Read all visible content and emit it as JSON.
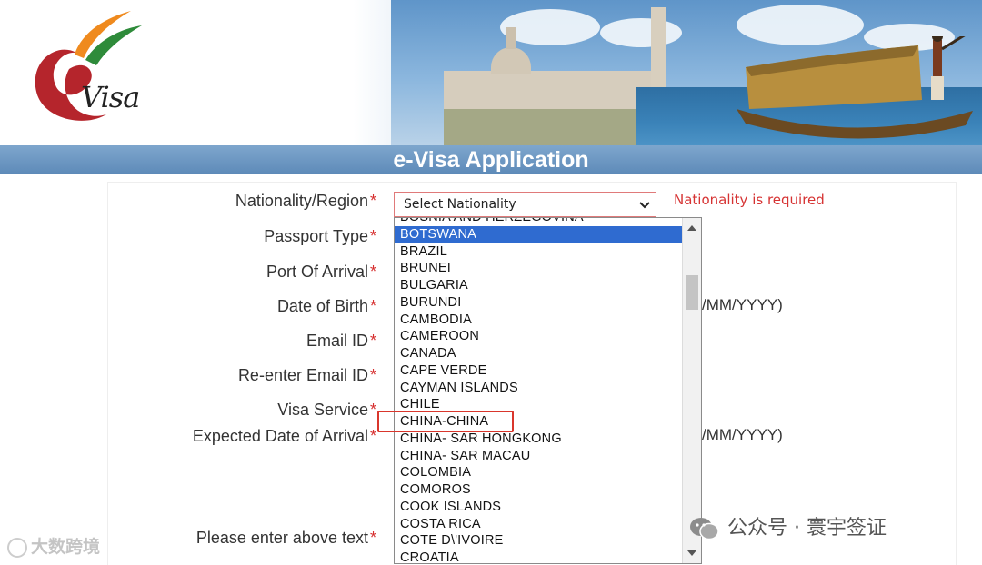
{
  "banner": {
    "logo_text": "Visa",
    "title": "e-Visa Application"
  },
  "form": {
    "labels": {
      "nationality": "Nationality/Region",
      "passport_type": "Passport Type",
      "port_of_arrival": "Port Of Arrival",
      "date_of_birth": "Date of Birth",
      "email": "Email ID",
      "reenter_email": "Re-enter Email ID",
      "visa_service": "Visa Service",
      "expected_arrival": "Expected Date of Arrival",
      "captcha": "Please enter above text"
    },
    "required_mark": "*",
    "date_hint": "/MM/YYYY)",
    "nationality_select": {
      "value": "Select Nationality",
      "error": "Nationality is required"
    }
  },
  "dropdown": {
    "selected": "BOTSWANA",
    "highlighted_by_annotation": "CHINA-CHINA",
    "options": [
      "BOSNIA AND HERZEGOVINA",
      "BOTSWANA",
      "BRAZIL",
      "BRUNEI",
      "BULGARIA",
      "BURUNDI",
      "CAMBODIA",
      "CAMEROON",
      "CANADA",
      "CAPE VERDE",
      "CAYMAN ISLANDS",
      "CHILE",
      "CHINA-CHINA",
      "CHINA- SAR HONGKONG",
      "CHINA- SAR MACAU",
      "COLOMBIA",
      "COMOROS",
      "COOK ISLANDS",
      "COSTA RICA",
      "COTE D\\'IVOIRE",
      "CROATIA"
    ]
  },
  "watermarks": {
    "left": "大数跨境",
    "right": "公众号 · 寰宇签证"
  },
  "colors": {
    "accent": "#5d8ab8",
    "error": "#d63333",
    "selected_option": "#2f6bd0",
    "annotation_box": "#d9362c"
  }
}
